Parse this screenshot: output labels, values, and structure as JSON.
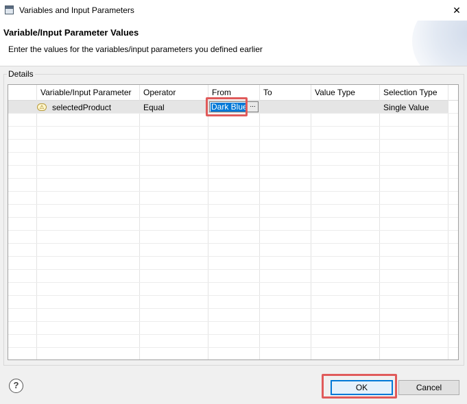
{
  "window": {
    "title": "Variables and Input Parameters",
    "close_symbol": "✕"
  },
  "header": {
    "title": "Variable/Input Parameter Values",
    "description": "Enter the values for the variables/input parameters you defined earlier"
  },
  "details": {
    "group_label": "Details",
    "columns": [
      "Variable/Input Parameter",
      "Operator",
      "From",
      "To",
      "Value Type",
      "Selection Type"
    ],
    "rows": [
      {
        "icon": "warning-icon",
        "variable": "selectedProduct",
        "operator": "Equal",
        "from": "Dark Blue",
        "to": "",
        "value_type": "",
        "selection_type": "Single Value"
      }
    ],
    "from_browse_label": "..."
  },
  "footer": {
    "help_symbol": "?",
    "ok_label": "OK",
    "cancel_label": "Cancel"
  },
  "colors": {
    "highlight": "#e05a5a",
    "selection": "#0078d7"
  }
}
